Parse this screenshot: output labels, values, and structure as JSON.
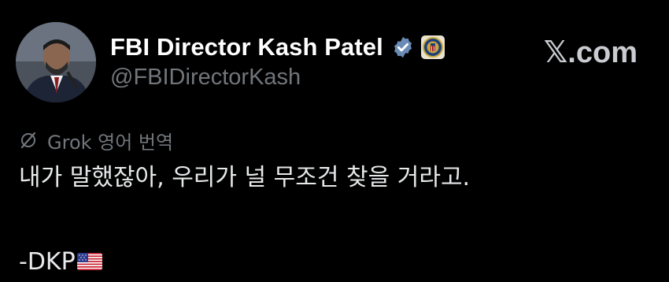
{
  "author": {
    "display_name": "FBI Director Kash Patel",
    "handle": "@FBIDirectorKash",
    "verified_icon": "verified-badge-icon",
    "affiliation_icon": "fbi-seal-icon"
  },
  "watermark": {
    "text": "𝕏.com"
  },
  "translation": {
    "icon": "grok-icon",
    "label": "Grok 영어 번역"
  },
  "tweet": {
    "body": "내가 말했잖아, 우리가 널 무조건 찾을 거라고.",
    "signature": "-DKP",
    "flag_icon": "us-flag-icon"
  },
  "colors": {
    "background": "#000000",
    "primary_text": "#e7e9ea",
    "secondary_text": "#71767b",
    "verified_blue": "#6a8bb5"
  }
}
